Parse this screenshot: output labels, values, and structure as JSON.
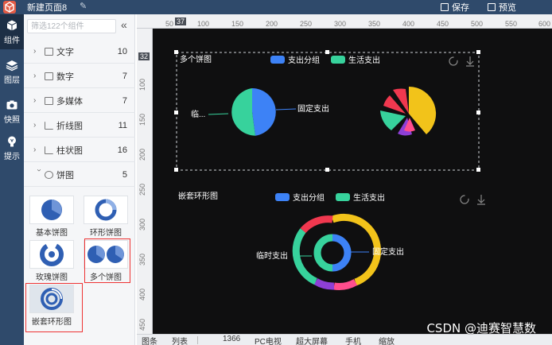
{
  "topbar": {
    "title": "新建页面8",
    "save_label": "保存",
    "preview_label": "预览"
  },
  "rail": [
    {
      "label": "组件",
      "icon": "cube-icon"
    },
    {
      "label": "图层",
      "icon": "layers-icon"
    },
    {
      "label": "快照",
      "icon": "camera-icon"
    },
    {
      "label": "提示",
      "icon": "lightbulb-icon"
    }
  ],
  "panel": {
    "search_placeholder": "筛选122个组件",
    "categories": [
      {
        "label": "文字",
        "count": "10",
        "icon": "text-icon"
      },
      {
        "label": "数字",
        "count": "7",
        "icon": "number-icon"
      },
      {
        "label": "多媒体",
        "count": "7",
        "icon": "media-icon"
      },
      {
        "label": "折线图",
        "count": "11",
        "icon": "line-chart-icon"
      },
      {
        "label": "柱状图",
        "count": "16",
        "icon": "bar-chart-icon"
      },
      {
        "label": "饼图",
        "count": "5",
        "icon": "pie-chart-icon"
      }
    ],
    "pie_items": [
      {
        "label": "基本饼图"
      },
      {
        "label": "环形饼图"
      },
      {
        "label": "玫瑰饼图"
      },
      {
        "label": "多个饼图"
      },
      {
        "label": "嵌套环形图"
      }
    ]
  },
  "ruler": {
    "h_ticks": [
      "50",
      "100",
      "150",
      "200",
      "250",
      "300",
      "350",
      "400",
      "450",
      "500",
      "550",
      "600"
    ],
    "v_ticks": [
      "100",
      "150",
      "200",
      "250",
      "300",
      "350",
      "400",
      "450"
    ],
    "h_badge": "37",
    "v_badge": "32"
  },
  "canvas": {
    "multi_pie": {
      "title": "多个饼图",
      "legend": [
        "支出分组",
        "生活支出"
      ],
      "label_left": "临...",
      "label_right": "固定支出"
    },
    "nested_ring": {
      "title": "嵌套环形图",
      "legend": [
        "支出分组",
        "生活支出"
      ],
      "label_left": "临时支出",
      "label_right": "固定支出"
    }
  },
  "colors": {
    "blue": "#3d82f6",
    "green": "#37d29c",
    "yellow": "#f2c31a",
    "red": "#f0384f",
    "purple": "#8e3fd6",
    "pink": "#ff4d8d"
  },
  "bottombar": {
    "items": [
      "图条",
      "列表",
      "1366",
      "PC电视",
      "超大屏幕",
      "手机",
      "缩放"
    ]
  },
  "watermark": "CSDN @迪赛智慧数"
}
